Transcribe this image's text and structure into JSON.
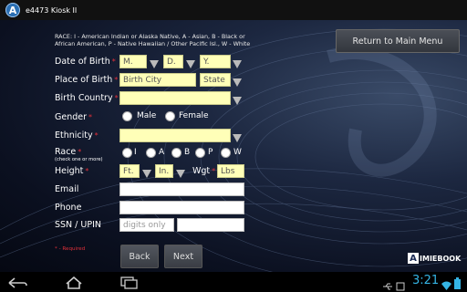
{
  "app": {
    "icon_letter": "A",
    "title": "e4473 Kiosk II"
  },
  "race_note": "RACE: I - American Indian or Alaska Native, A - Asian, B - Black or African American, P - Native Hawaiian / Other Pacific Isl., W - White",
  "return_button": "Return to Main Menu",
  "required_mark": "*",
  "form": {
    "dob_label": "Date of Birth",
    "dob_month": "M.",
    "dob_day": "D.",
    "dob_year": "Y.",
    "pob_label": "Place of Birth",
    "pob_city": "Birth City",
    "pob_state": "State",
    "country_label": "Birth Country",
    "country_value": "",
    "gender_label": "Gender",
    "gender_male": "Male",
    "gender_female": "Female",
    "ethnicity_label": "Ethnicity",
    "ethnicity_value": "",
    "race_label": "Race",
    "race_sub": "(check one or more)",
    "race_options": [
      "I",
      "A",
      "B",
      "P",
      "W"
    ],
    "height_label": "Height",
    "height_ft": "Ft.",
    "height_in": "In.",
    "weight_label": "Wgt",
    "weight_lbs": "Lbs",
    "email_label": "Email",
    "email_value": "",
    "phone_label": "Phone",
    "phone_value": "",
    "ssn_label": "SSN / UPIN",
    "ssn_placeholder": "digits only",
    "upin_value": ""
  },
  "required_note": "* - Required",
  "buttons": {
    "back": "Back",
    "next": "Next"
  },
  "logo": {
    "letter": "A",
    "text": "IMIEBOOK"
  },
  "system_bar": {
    "clock": "3:21"
  },
  "colors": {
    "required": "#e0303a",
    "input_yellow": "#ffffb8",
    "clock": "#35b5e5"
  }
}
